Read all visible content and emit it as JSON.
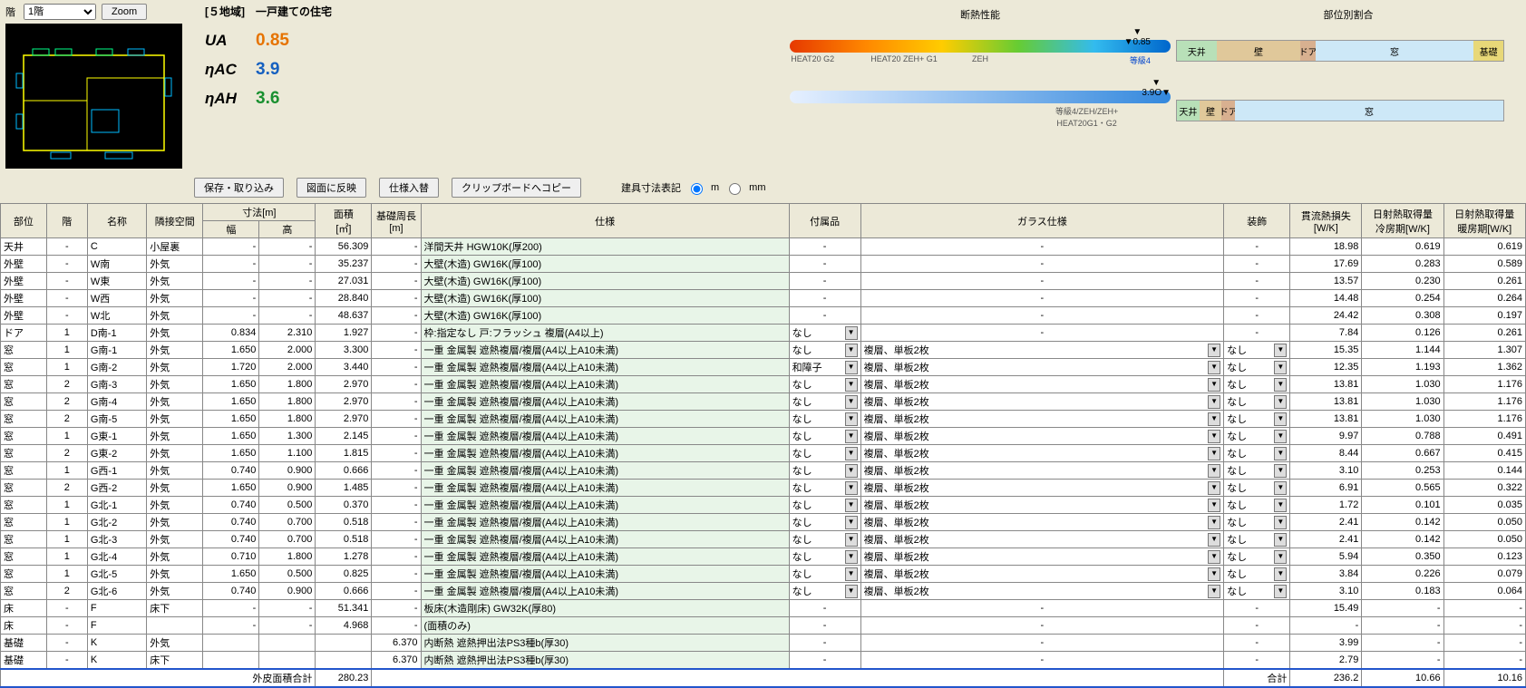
{
  "floorLabel": "階",
  "floorSel": "1階",
  "zoom": "Zoom",
  "title": "[５地域]　一戸建ての住宅",
  "uaLbl": "UA",
  "uaVal": "0.85",
  "acLbl": "ηAC",
  "acVal": "3.9",
  "ahLbl": "ηAH",
  "ahVal": "3.6",
  "perfTitle": "断熱性能",
  "ticks": {
    "g2": "HEAT20\nG2",
    "g1": "HEAT20 ZEH+\nG1",
    "zeh": "ZEH",
    "grade4": "等級4",
    "mark1": "▼0.85",
    "mark2": "3.9O▼",
    "sub2": "等級4/ZEH/ZEH+\nHEAT20G1・G2"
  },
  "ratioTitle": "部位別割合",
  "segs": {
    "ceil": "天井",
    "wall": "壁",
    "door": "ドア",
    "win": "窓",
    "found": "基礎"
  },
  "btns": {
    "save": "保存・取り込み",
    "reflect": "図面に反映",
    "swap": "仕様入替",
    "clip": "クリップボードへコピー"
  },
  "dimLabel": "建具寸法表記",
  "unitM": "m",
  "unitMm": "mm",
  "hdr": {
    "part": "部位",
    "floor": "階",
    "name": "名称",
    "adj": "隣接空間",
    "dim": "寸法[m]",
    "w": "幅",
    "h": "高",
    "area": "面積\n[㎡]",
    "perim": "基礎周長\n[m]",
    "spec": "仕様",
    "acc": "付属品",
    "glass": "ガラス仕様",
    "deco": "装飾",
    "loss": "貫流熱損失\n[W/K]",
    "cool": "日射熱取得量\n冷房期[W/K]",
    "heat": "日射熱取得量\n暖房期[W/K]"
  },
  "rows": [
    {
      "p": "天井",
      "f": "-",
      "n": "C",
      "a": "小屋裏",
      "w": "-",
      "h": "-",
      "ar": "56.309",
      "pe": "-",
      "sp": "洋間天井 HGW10K(厚200)",
      "ac": "",
      "gl": "",
      "de": "-",
      "lo": "18.98",
      "co": "0.619",
      "he": "0.619"
    },
    {
      "p": "外壁",
      "f": "-",
      "n": "W南",
      "a": "外気",
      "w": "-",
      "h": "-",
      "ar": "35.237",
      "pe": "-",
      "sp": "大壁(木造) GW16K(厚100)",
      "ac": "",
      "gl": "",
      "de": "-",
      "lo": "17.69",
      "co": "0.283",
      "he": "0.589"
    },
    {
      "p": "外壁",
      "f": "-",
      "n": "W東",
      "a": "外気",
      "w": "-",
      "h": "-",
      "ar": "27.031",
      "pe": "-",
      "sp": "大壁(木造) GW16K(厚100)",
      "ac": "",
      "gl": "",
      "de": "-",
      "lo": "13.57",
      "co": "0.230",
      "he": "0.261"
    },
    {
      "p": "外壁",
      "f": "-",
      "n": "W西",
      "a": "外気",
      "w": "-",
      "h": "-",
      "ar": "28.840",
      "pe": "-",
      "sp": "大壁(木造) GW16K(厚100)",
      "ac": "",
      "gl": "",
      "de": "-",
      "lo": "14.48",
      "co": "0.254",
      "he": "0.264"
    },
    {
      "p": "外壁",
      "f": "-",
      "n": "W北",
      "a": "外気",
      "w": "-",
      "h": "-",
      "ar": "48.637",
      "pe": "-",
      "sp": "大壁(木造) GW16K(厚100)",
      "ac": "",
      "gl": "",
      "de": "-",
      "lo": "24.42",
      "co": "0.308",
      "he": "0.197"
    },
    {
      "p": "ドア",
      "f": "1",
      "n": "D南-1",
      "a": "外気",
      "w": "0.834",
      "h": "2.310",
      "ar": "1.927",
      "pe": "-",
      "sp": "枠:指定なし 戸:フラッシュ 複層(A4以上)",
      "ac": "なし",
      "acdd": 1,
      "gl": "",
      "de": "-",
      "lo": "7.84",
      "co": "0.126",
      "he": "0.261"
    },
    {
      "p": "窓",
      "f": "1",
      "n": "G南-1",
      "a": "外気",
      "w": "1.650",
      "h": "2.000",
      "ar": "3.300",
      "pe": "-",
      "sp": "一重 金属製 遮熱複層/複層(A4以上A10未満)",
      "ac": "なし",
      "acdd": 1,
      "gl": "複層、単板2枚",
      "gldd": 1,
      "de": "なし",
      "dedd": 1,
      "lo": "15.35",
      "co": "1.144",
      "he": "1.307"
    },
    {
      "p": "窓",
      "f": "1",
      "n": "G南-2",
      "a": "外気",
      "w": "1.720",
      "h": "2.000",
      "ar": "3.440",
      "pe": "-",
      "sp": "一重 金属製 遮熱複層/複層(A4以上A10未満)",
      "ac": "和障子",
      "acdd": 1,
      "gl": "複層、単板2枚",
      "gldd": 1,
      "de": "なし",
      "dedd": 1,
      "lo": "12.35",
      "co": "1.193",
      "he": "1.362"
    },
    {
      "p": "窓",
      "f": "2",
      "n": "G南-3",
      "a": "外気",
      "w": "1.650",
      "h": "1.800",
      "ar": "2.970",
      "pe": "-",
      "sp": "一重 金属製 遮熱複層/複層(A4以上A10未満)",
      "ac": "なし",
      "acdd": 1,
      "gl": "複層、単板2枚",
      "gldd": 1,
      "de": "なし",
      "dedd": 1,
      "lo": "13.81",
      "co": "1.030",
      "he": "1.176"
    },
    {
      "p": "窓",
      "f": "2",
      "n": "G南-4",
      "a": "外気",
      "w": "1.650",
      "h": "1.800",
      "ar": "2.970",
      "pe": "-",
      "sp": "一重 金属製 遮熱複層/複層(A4以上A10未満)",
      "ac": "なし",
      "acdd": 1,
      "gl": "複層、単板2枚",
      "gldd": 1,
      "de": "なし",
      "dedd": 1,
      "lo": "13.81",
      "co": "1.030",
      "he": "1.176"
    },
    {
      "p": "窓",
      "f": "2",
      "n": "G南-5",
      "a": "外気",
      "w": "1.650",
      "h": "1.800",
      "ar": "2.970",
      "pe": "-",
      "sp": "一重 金属製 遮熱複層/複層(A4以上A10未満)",
      "ac": "なし",
      "acdd": 1,
      "gl": "複層、単板2枚",
      "gldd": 1,
      "de": "なし",
      "dedd": 1,
      "lo": "13.81",
      "co": "1.030",
      "he": "1.176"
    },
    {
      "p": "窓",
      "f": "1",
      "n": "G東-1",
      "a": "外気",
      "w": "1.650",
      "h": "1.300",
      "ar": "2.145",
      "pe": "-",
      "sp": "一重 金属製 遮熱複層/複層(A4以上A10未満)",
      "ac": "なし",
      "acdd": 1,
      "gl": "複層、単板2枚",
      "gldd": 1,
      "de": "なし",
      "dedd": 1,
      "lo": "9.97",
      "co": "0.788",
      "he": "0.491"
    },
    {
      "p": "窓",
      "f": "2",
      "n": "G東-2",
      "a": "外気",
      "w": "1.650",
      "h": "1.100",
      "ar": "1.815",
      "pe": "-",
      "sp": "一重 金属製 遮熱複層/複層(A4以上A10未満)",
      "ac": "なし",
      "acdd": 1,
      "gl": "複層、単板2枚",
      "gldd": 1,
      "de": "なし",
      "dedd": 1,
      "lo": "8.44",
      "co": "0.667",
      "he": "0.415"
    },
    {
      "p": "窓",
      "f": "1",
      "n": "G西-1",
      "a": "外気",
      "w": "0.740",
      "h": "0.900",
      "ar": "0.666",
      "pe": "-",
      "sp": "一重 金属製 遮熱複層/複層(A4以上A10未満)",
      "ac": "なし",
      "acdd": 1,
      "gl": "複層、単板2枚",
      "gldd": 1,
      "de": "なし",
      "dedd": 1,
      "lo": "3.10",
      "co": "0.253",
      "he": "0.144"
    },
    {
      "p": "窓",
      "f": "2",
      "n": "G西-2",
      "a": "外気",
      "w": "1.650",
      "h": "0.900",
      "ar": "1.485",
      "pe": "-",
      "sp": "一重 金属製 遮熱複層/複層(A4以上A10未満)",
      "ac": "なし",
      "acdd": 1,
      "gl": "複層、単板2枚",
      "gldd": 1,
      "de": "なし",
      "dedd": 1,
      "lo": "6.91",
      "co": "0.565",
      "he": "0.322"
    },
    {
      "p": "窓",
      "f": "1",
      "n": "G北-1",
      "a": "外気",
      "w": "0.740",
      "h": "0.500",
      "ar": "0.370",
      "pe": "-",
      "sp": "一重 金属製 遮熱複層/複層(A4以上A10未満)",
      "ac": "なし",
      "acdd": 1,
      "gl": "複層、単板2枚",
      "gldd": 1,
      "de": "なし",
      "dedd": 1,
      "lo": "1.72",
      "co": "0.101",
      "he": "0.035"
    },
    {
      "p": "窓",
      "f": "1",
      "n": "G北-2",
      "a": "外気",
      "w": "0.740",
      "h": "0.700",
      "ar": "0.518",
      "pe": "-",
      "sp": "一重 金属製 遮熱複層/複層(A4以上A10未満)",
      "ac": "なし",
      "acdd": 1,
      "gl": "複層、単板2枚",
      "gldd": 1,
      "de": "なし",
      "dedd": 1,
      "lo": "2.41",
      "co": "0.142",
      "he": "0.050"
    },
    {
      "p": "窓",
      "f": "1",
      "n": "G北-3",
      "a": "外気",
      "w": "0.740",
      "h": "0.700",
      "ar": "0.518",
      "pe": "-",
      "sp": "一重 金属製 遮熱複層/複層(A4以上A10未満)",
      "ac": "なし",
      "acdd": 1,
      "gl": "複層、単板2枚",
      "gldd": 1,
      "de": "なし",
      "dedd": 1,
      "lo": "2.41",
      "co": "0.142",
      "he": "0.050"
    },
    {
      "p": "窓",
      "f": "1",
      "n": "G北-4",
      "a": "外気",
      "w": "0.710",
      "h": "1.800",
      "ar": "1.278",
      "pe": "-",
      "sp": "一重 金属製 遮熱複層/複層(A4以上A10未満)",
      "ac": "なし",
      "acdd": 1,
      "gl": "複層、単板2枚",
      "gldd": 1,
      "de": "なし",
      "dedd": 1,
      "lo": "5.94",
      "co": "0.350",
      "he": "0.123"
    },
    {
      "p": "窓",
      "f": "1",
      "n": "G北-5",
      "a": "外気",
      "w": "1.650",
      "h": "0.500",
      "ar": "0.825",
      "pe": "-",
      "sp": "一重 金属製 遮熱複層/複層(A4以上A10未満)",
      "ac": "なし",
      "acdd": 1,
      "gl": "複層、単板2枚",
      "gldd": 1,
      "de": "なし",
      "dedd": 1,
      "lo": "3.84",
      "co": "0.226",
      "he": "0.079"
    },
    {
      "p": "窓",
      "f": "2",
      "n": "G北-6",
      "a": "外気",
      "w": "0.740",
      "h": "0.900",
      "ar": "0.666",
      "pe": "-",
      "sp": "一重 金属製 遮熱複層/複層(A4以上A10未満)",
      "ac": "なし",
      "acdd": 1,
      "gl": "複層、単板2枚",
      "gldd": 1,
      "de": "なし",
      "dedd": 1,
      "lo": "3.10",
      "co": "0.183",
      "he": "0.064"
    },
    {
      "p": "床",
      "f": "-",
      "n": "F",
      "a": "床下",
      "w": "-",
      "h": "-",
      "ar": "51.341",
      "pe": "-",
      "sp": "板床(木造剛床) GW32K(厚80)",
      "ac": "",
      "gl": "",
      "de": "-",
      "lo": "15.49",
      "co": "-",
      "he": "-"
    },
    {
      "p": "床",
      "f": "-",
      "n": "F",
      "a": "",
      "w": "-",
      "h": "-",
      "ar": "4.968",
      "pe": "-",
      "sp": "(面積のみ)",
      "ac": "",
      "gl": "",
      "de": "-",
      "lo": "-",
      "co": "-",
      "he": "-"
    },
    {
      "p": "基礎",
      "f": "-",
      "n": "K",
      "a": "外気",
      "w": "",
      "h": "",
      "ar": "",
      "pe": "6.370",
      "sp": "内断熱 遮熱押出法PS3種b(厚30)",
      "ac": "",
      "gl": "",
      "de": "-",
      "lo": "3.99",
      "co": "-",
      "he": "-"
    },
    {
      "p": "基礎",
      "f": "-",
      "n": "K",
      "a": "床下",
      "w": "",
      "h": "",
      "ar": "",
      "pe": "6.370",
      "sp": "内断熱 遮熱押出法PS3種b(厚30)",
      "ac": "",
      "gl": "",
      "de": "-",
      "lo": "2.79",
      "co": "-",
      "he": "-"
    }
  ],
  "total": {
    "lbl": "外皮面積合計",
    "area": "280.23",
    "sumLbl": "合計",
    "loss": "236.2",
    "cool": "10.66",
    "heat": "10.16"
  }
}
